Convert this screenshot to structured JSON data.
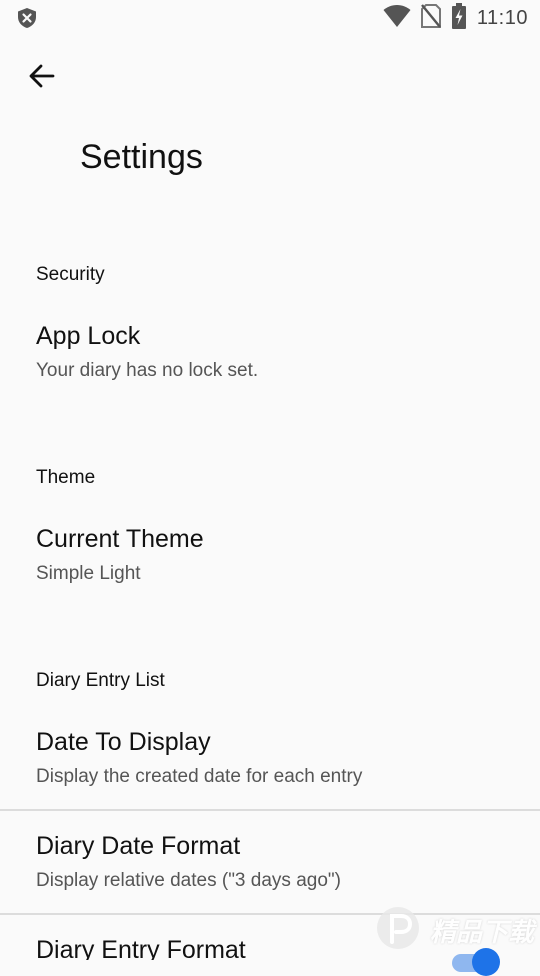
{
  "status_bar": {
    "time": "11:10",
    "icons": [
      "shield-icon",
      "wifi-icon",
      "no-sim-icon",
      "battery-charging-icon"
    ]
  },
  "toolbar": {
    "back_icon": "arrow-back-icon",
    "title": "Settings"
  },
  "sections": [
    {
      "header": "Security",
      "items": [
        {
          "title": "App Lock",
          "summary": "Your diary has no lock set."
        }
      ]
    },
    {
      "header": "Theme",
      "items": [
        {
          "title": "Current Theme",
          "summary": "Simple Light"
        }
      ]
    },
    {
      "header": "Diary Entry List",
      "items": [
        {
          "title": "Date To Display",
          "summary": "Display the created date for each entry"
        },
        {
          "title": "Diary Date Format",
          "summary": "Display relative dates (\"3 days ago\")"
        },
        {
          "title": "Diary Entry Format",
          "summary": "",
          "toggle_on": true
        }
      ]
    }
  ],
  "watermark": {
    "text": "精品下载"
  },
  "colors": {
    "background": "#fafafa",
    "accent": "#1e73e8",
    "divider": "#dcdcdc"
  }
}
